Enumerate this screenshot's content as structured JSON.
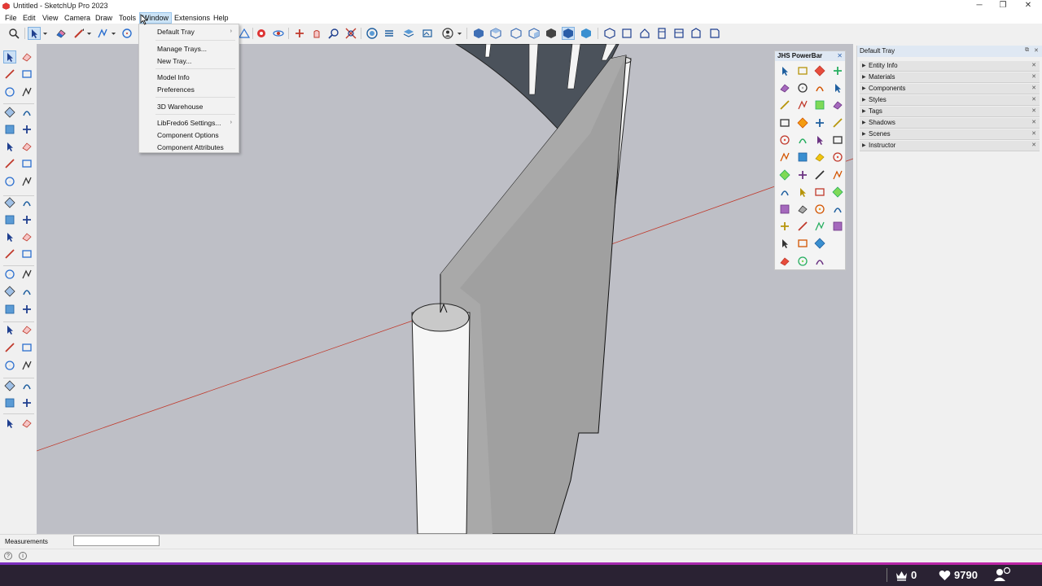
{
  "window": {
    "title": "Untitled - SketchUp Pro 2023",
    "controls": {
      "minimize": "─",
      "restore": "❐",
      "close": "✕"
    }
  },
  "menubar": {
    "items": [
      "File",
      "Edit",
      "View",
      "Camera",
      "Draw",
      "Tools",
      "Window",
      "Extensions",
      "Help"
    ],
    "active": "Window"
  },
  "window_menu": {
    "items": [
      {
        "label": "Default Tray",
        "submenu": true
      },
      {
        "label": "Manage Trays...",
        "submenu": false
      },
      {
        "label": "New Tray...",
        "submenu": false
      },
      {
        "label": "Model Info",
        "submenu": false
      },
      {
        "label": "Preferences",
        "submenu": false
      },
      {
        "label": "3D Warehouse",
        "submenu": false
      },
      {
        "label": "LibFredo6 Settings...",
        "submenu": true
      },
      {
        "label": "Component Options",
        "submenu": false
      },
      {
        "label": "Component Attributes",
        "submenu": false
      }
    ],
    "submenu_glyph": "›"
  },
  "tray": {
    "title": "Default Tray",
    "controls": {
      "pin": "⧉",
      "close": "✕"
    },
    "panels": [
      "Entity Info",
      "Materials",
      "Components",
      "Styles",
      "Tags",
      "Shadows",
      "Scenes",
      "Instructor"
    ],
    "panel_arrow": "▶",
    "panel_close": "✕"
  },
  "powerbar": {
    "title": "JHS PowerBar",
    "close": "✕"
  },
  "measurements": {
    "label": "Measurements",
    "value": ""
  },
  "hint_icons": [
    "?",
    "i"
  ],
  "stream": {
    "viewers": "0",
    "likes": "9790"
  },
  "colors": {
    "viewport_bg": "#bebfc6",
    "red_axis": "#c0392b",
    "face_gray": "#9c9c9c",
    "dark_face": "#4a5059",
    "selection_blue": "#cbe0f5",
    "stream_bg": "#2a2233"
  }
}
